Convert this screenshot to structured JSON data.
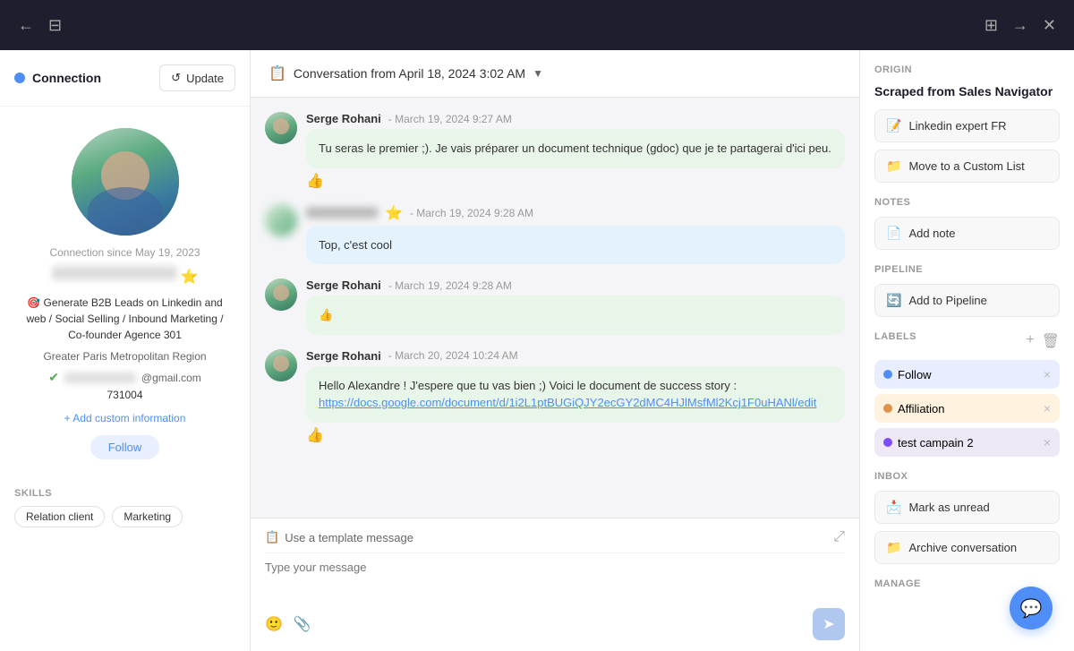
{
  "topbar": {
    "back_icon": "←",
    "panel_icon_left": "⊟",
    "panel_icon_right": "⊞",
    "forward_icon": "→",
    "close_icon": "✕"
  },
  "left_panel": {
    "connection_label": "Connection",
    "update_label": "Update",
    "connection_since": "Connection since May 19, 2023",
    "tagline": "🎯 Generate B2B Leads on Linkedin and web / Social Selling / Inbound Marketing / Co-founder Agence 301",
    "location": "Greater Paris Metropolitan Region",
    "email_suffix": "@gmail.com",
    "phone": "731004",
    "add_custom_label": "+ Add custom information",
    "follow_label": "Follow",
    "skills_label": "SKILLS",
    "skills": [
      "Relation client",
      "Marketing"
    ]
  },
  "conversation": {
    "header_icon": "📋",
    "title": "Conversation from April 18, 2024 3:02 AM",
    "dropdown": "▼",
    "messages": [
      {
        "sender": "Serge Rohani",
        "time": "March 19, 2024 9:27 AM",
        "text": "Tu seras le premier ;). Je vais préparer un document technique (gdoc) que je te partagerai d'ici peu.",
        "emoji": "👍",
        "type": "green",
        "is_self": true
      },
      {
        "sender": "",
        "star": "⭐",
        "time": "March 19, 2024 9:28 AM",
        "text": "Top, c'est cool",
        "type": "blue",
        "is_self": false
      },
      {
        "sender": "Serge Rohani",
        "time": "March 19, 2024 9:28 AM",
        "text": "👍",
        "type": "green",
        "is_self": true
      },
      {
        "sender": "Serge Rohani",
        "time": "March 20, 2024 10:24 AM",
        "text": "Hello Alexandre ! J'espere que tu vas bien ;)\nVoici le document de success story :",
        "link": "https://docs.google.com/document/d/1i2L1ptBUGiQJY2ecGY2dMC4HJlMsfMl2Kcj1F0uHANl/edit",
        "emoji": "👍",
        "type": "green",
        "is_self": true
      }
    ],
    "template_label": "Use a template message",
    "input_placeholder": "Type your message"
  },
  "right_panel": {
    "origin_section": "ORIGIN",
    "origin_title": "Scraped from Sales Navigator",
    "linkedin_btn": "Linkedin expert FR",
    "move_list_btn": "Move to a Custom List",
    "notes_section": "NOTES",
    "add_note_btn": "Add note",
    "pipeline_section": "PIPELINE",
    "add_pipeline_btn": "Add to Pipeline",
    "labels_section": "LABELS",
    "labels": [
      {
        "text": "Follow",
        "type": "follow",
        "color": "#4f8ef7"
      },
      {
        "text": "Affiliation",
        "type": "affiliation",
        "color": "#e0924a"
      },
      {
        "text": "test campain 2",
        "type": "test",
        "color": "#7c4dff"
      }
    ],
    "inbox_section": "INBOX",
    "mark_unread_btn": "Mark as unread",
    "archive_btn": "Archive conversation",
    "manage_section": "MANAGE"
  }
}
